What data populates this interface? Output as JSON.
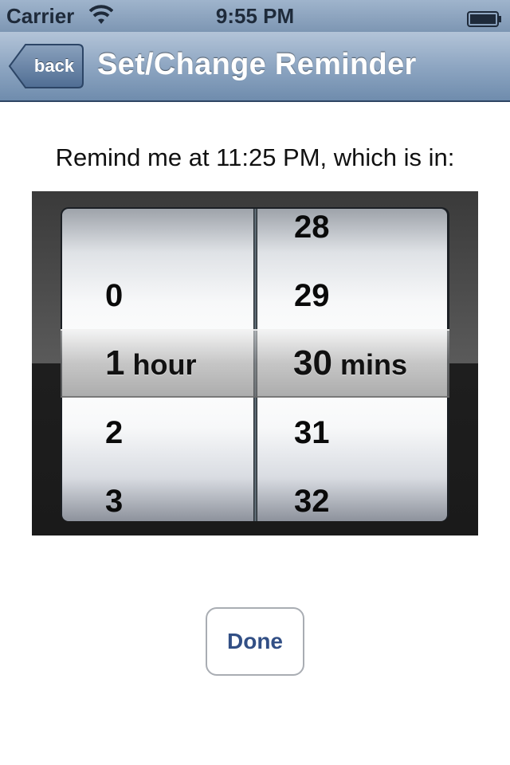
{
  "status_bar": {
    "carrier": "Carrier",
    "time": "9:55 PM",
    "wifi_icon": "wifi-icon",
    "battery_icon": "battery-icon"
  },
  "nav_bar": {
    "back_label": "back",
    "title": "Set/Change Reminder"
  },
  "reminder_text": "Remind me at 11:25 PM, which is in:",
  "picker": {
    "hours": {
      "options": [
        "",
        "0",
        "1",
        "2",
        "3"
      ],
      "selected_value": "1",
      "selected_unit": "hour"
    },
    "minutes": {
      "options": [
        "28",
        "29",
        "30",
        "31",
        "32"
      ],
      "selected_value": "30",
      "selected_unit": "mins"
    }
  },
  "done_label": "Done",
  "colors": {
    "nav_bar": "#8ea6c2",
    "done_text": "#324f85"
  }
}
